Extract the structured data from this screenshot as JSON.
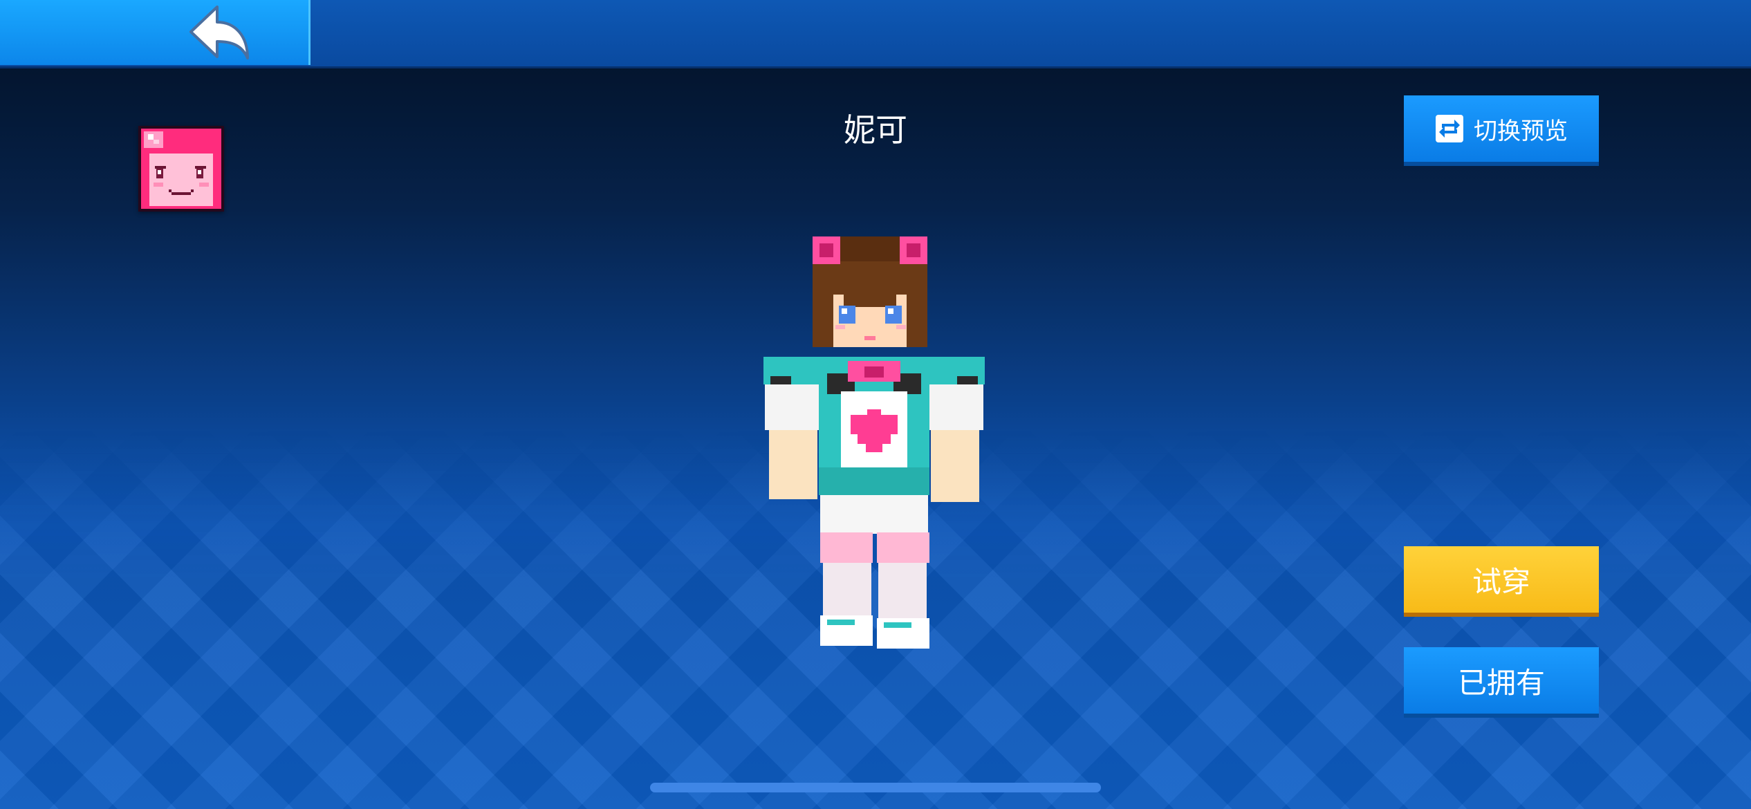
{
  "header": {
    "back_icon": "back-arrow-icon"
  },
  "avatar": {
    "icon": "pink-face-avatar-icon"
  },
  "skin": {
    "name": "妮可"
  },
  "actions": {
    "switch_preview_label": "切换预览",
    "switch_icon": "refresh-swap-icon",
    "try_on_label": "试穿",
    "owned_label": "已拥有"
  },
  "colors": {
    "accent_blue": "#0c86ea",
    "try_on_yellow": "#ffc928",
    "avatar_pink": "#ff2c7d"
  }
}
